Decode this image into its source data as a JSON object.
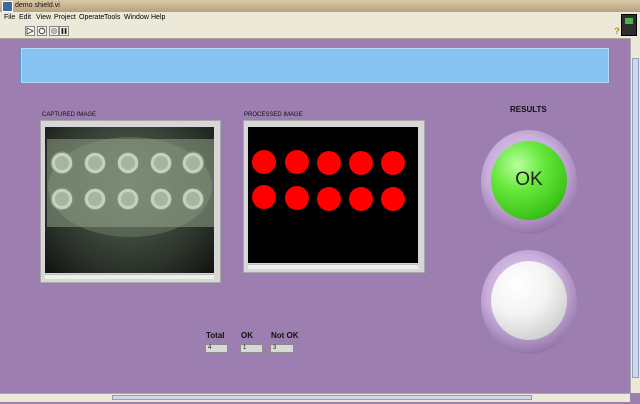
{
  "window": {
    "title": "demo shield.vi"
  },
  "menu": [
    "File",
    "Edit",
    "View",
    "Project",
    "Operate",
    "Tools",
    "Window",
    "Help"
  ],
  "toolbar": {
    "run_icon": "run-arrow-icon",
    "run_continuous_icon": "run-continuously-icon",
    "abort_icon": "abort-icon",
    "pause_icon": "pause-icon",
    "help_glyph": "?"
  },
  "panels": {
    "captured_label": "CAPTURED IMAGE",
    "processed_label": "PROCESSED IMAGE"
  },
  "results": {
    "label": "RESULTS",
    "ok_led_text": "OK",
    "ok_led_color": "#4fd42a",
    "off_led_color": "#f2f2f2"
  },
  "indicators": {
    "total_label": "Total",
    "total_value": "4",
    "ok_label": "OK",
    "ok_value": "1",
    "notok_label": "Not OK",
    "notok_value": "3"
  },
  "colors": {
    "panel_background": "#9c7fb0",
    "blue_bar": "#87c3f0",
    "blob_red": "#ff0000"
  }
}
